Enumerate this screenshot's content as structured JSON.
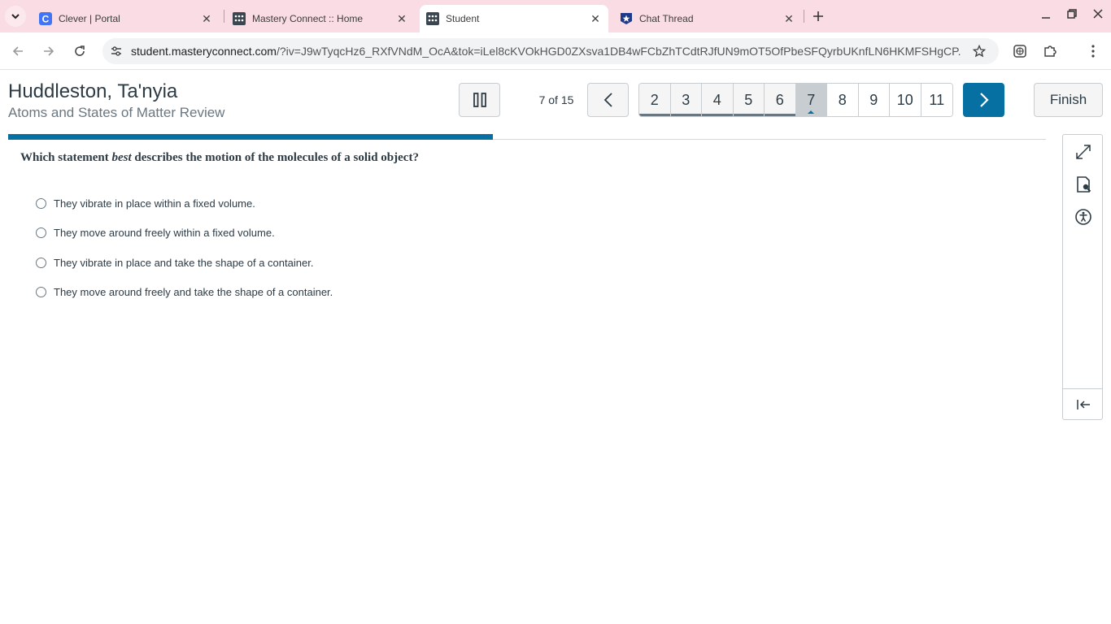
{
  "browser": {
    "tabs": [
      {
        "title": "Clever | Portal",
        "icon": "clever-icon",
        "active": false
      },
      {
        "title": "Mastery Connect :: Home",
        "icon": "mastery-connect-icon",
        "active": false
      },
      {
        "title": "Student",
        "icon": "mastery-connect-icon",
        "active": true
      },
      {
        "title": "Chat Thread",
        "icon": "star-badge-icon",
        "active": false
      }
    ],
    "url_host": "student.masteryconnect.com",
    "url_rest": "/?iv=J9wTyqcHz6_RXfVNdM_OcA&tok=iLel8cKVOkHGD0ZXsva1DB4wFCbZhTCdtRJfUN9mOT5OfPbeSFQyrbUKnfLN6HKMFSHgCP..."
  },
  "header": {
    "student_name": "Huddleston, Ta'nyia",
    "assessment_title": "Atoms and States of Matter Review",
    "position_text": "7 of 15",
    "finish_label": "Finish"
  },
  "question_nav": [
    {
      "num": "2",
      "state": "answered"
    },
    {
      "num": "3",
      "state": "answered"
    },
    {
      "num": "4",
      "state": "answered"
    },
    {
      "num": "5",
      "state": "answered"
    },
    {
      "num": "6",
      "state": "answered"
    },
    {
      "num": "7",
      "state": "current"
    },
    {
      "num": "8",
      "state": "plain"
    },
    {
      "num": "9",
      "state": "plain"
    },
    {
      "num": "10",
      "state": "plain"
    },
    {
      "num": "11",
      "state": "plain"
    }
  ],
  "progress": {
    "fraction": 0.467
  },
  "question": {
    "prefix": "Which statement ",
    "emphasis": "best",
    "suffix": " describes the motion of the molecules of a solid object?",
    "choices": [
      "They vibrate in place within a fixed volume.",
      "They move around freely within a fixed volume.",
      "They vibrate in place and take the shape of a container.",
      "They move around freely and take the shape of a container."
    ]
  },
  "colors": {
    "accent": "#0770a3",
    "tabbar": "#f9dce4",
    "text": "#2d3b45"
  }
}
